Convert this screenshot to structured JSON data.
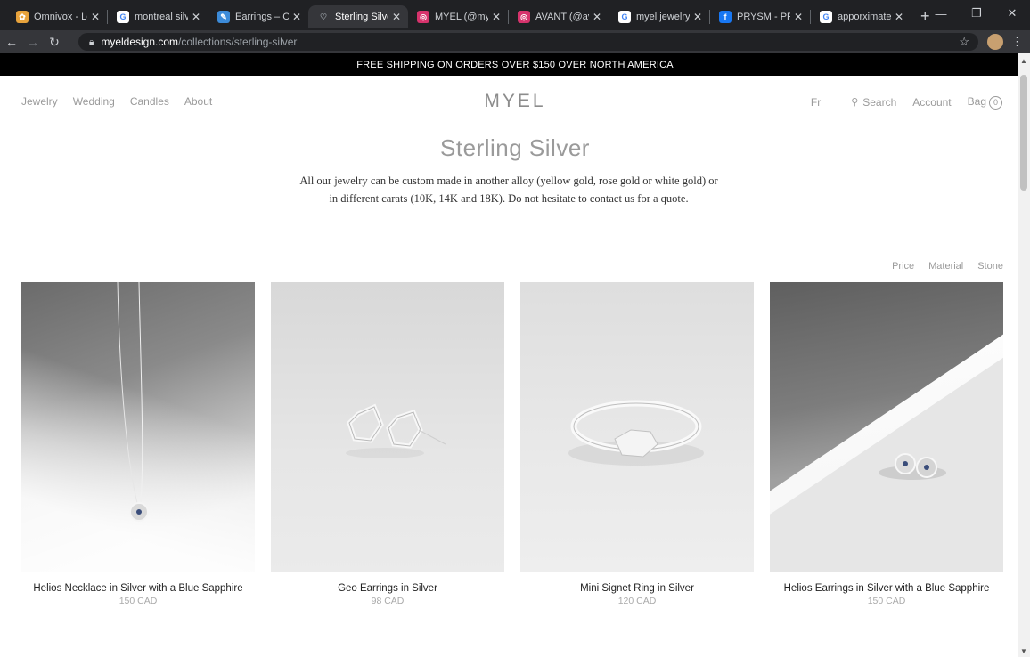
{
  "browser": {
    "tabs": [
      {
        "title": "Omnivox - Léa",
        "favicon_color": "#e8a33c",
        "active": false
      },
      {
        "title": "montreal silve",
        "favicon_color": "#ffffff",
        "active": false
      },
      {
        "title": "Earrings – Cym",
        "favicon_color": "#3c8bd9",
        "active": false
      },
      {
        "title": "Sterling Silver",
        "favicon_color": "#35363a",
        "active": true
      },
      {
        "title": "MYEL (@myel",
        "favicon_color": "#d6336c",
        "active": false
      },
      {
        "title": "AVANT (@ava",
        "favicon_color": "#d6336c",
        "active": false
      },
      {
        "title": "myel jewelry",
        "favicon_color": "#ffffff",
        "active": false
      },
      {
        "title": "PRYSM - PRYS",
        "favicon_color": "#1877f2",
        "active": false
      },
      {
        "title": "apporximately",
        "favicon_color": "#ffffff",
        "active": false
      }
    ],
    "url_host": "myeldesign.com",
    "url_path": "/collections/sterling-silver"
  },
  "announcement": "FREE SHIPPING ON ORDERS OVER $150 OVER NORTH AMERICA",
  "header": {
    "nav": [
      "Jewelry",
      "Wedding",
      "Candles",
      "About"
    ],
    "logo": "MYEL",
    "lang": "Fr",
    "search": "Search",
    "account": "Account",
    "bag": "Bag",
    "bag_count": "0"
  },
  "collection": {
    "title": "Sterling Silver",
    "description": "All our jewelry can be custom made in another alloy (yellow gold, rose gold or white gold) or in different carats (10K, 14K and 18K). Do not hesitate to contact us for a quote."
  },
  "filters": [
    "Price",
    "Material",
    "Stone"
  ],
  "products": [
    {
      "name": "Helios Necklace in Silver with a Blue Sapphire",
      "price": "150 CAD"
    },
    {
      "name": "Geo Earrings in Silver",
      "price": "98 CAD"
    },
    {
      "name": "Mini Signet Ring in Silver",
      "price": "120 CAD"
    },
    {
      "name": "Helios Earrings in Silver with a Blue Sapphire",
      "price": "150 CAD"
    }
  ]
}
